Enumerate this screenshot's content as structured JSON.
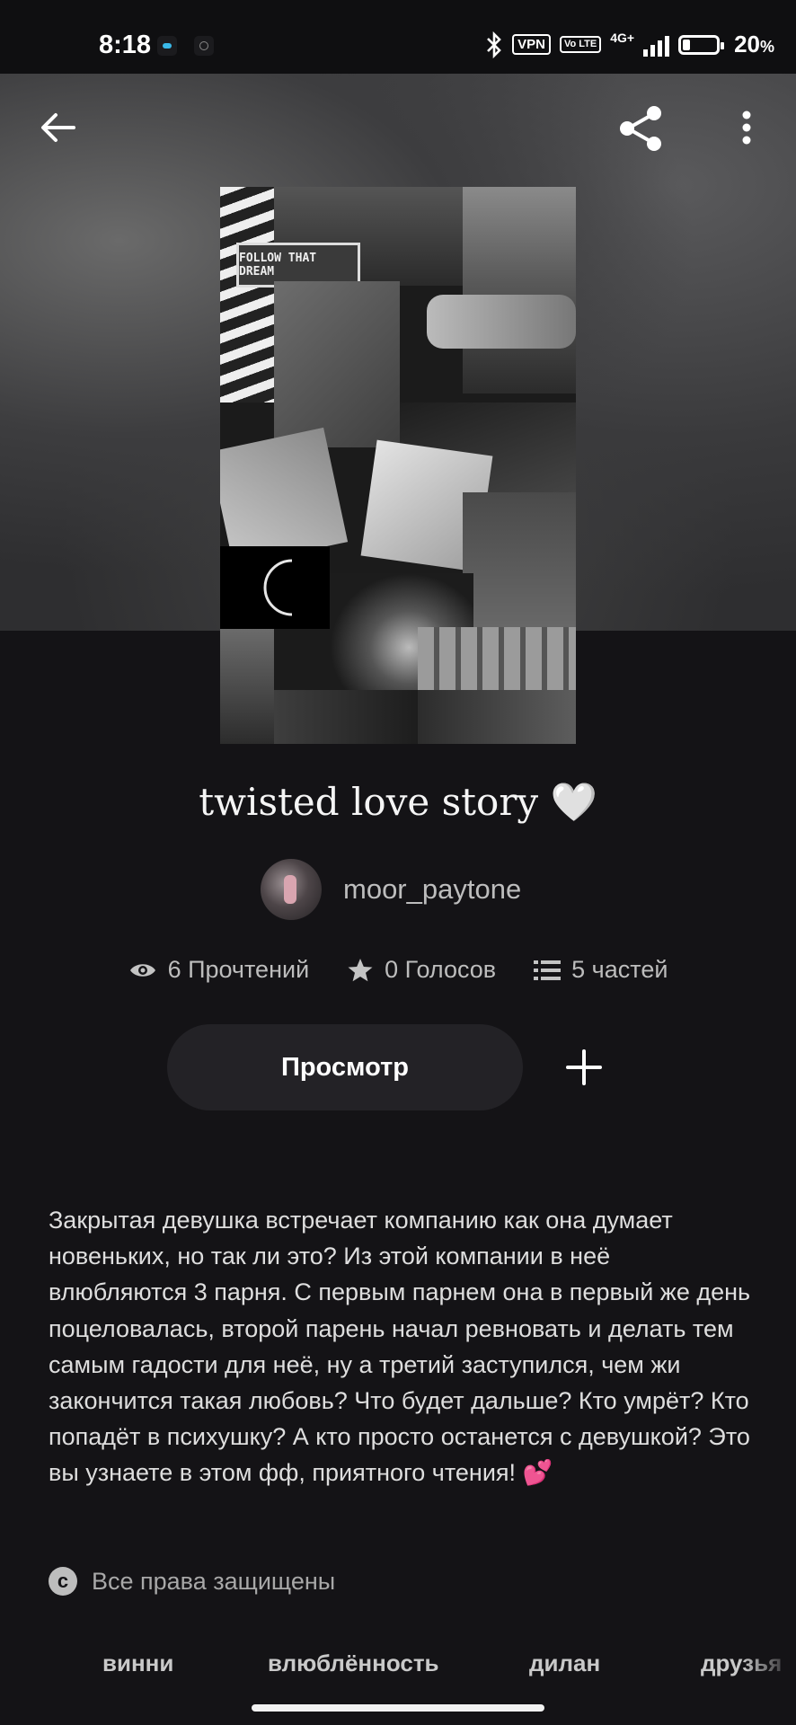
{
  "status_bar": {
    "time": "8:18",
    "vpn": "VPN",
    "volte": "Vo LTE",
    "network": "4G+",
    "battery": "20",
    "battery_unit": "%"
  },
  "header": {
    "back_icon": "arrow-left-icon",
    "share_icon": "share-icon",
    "more_icon": "more-vertical-icon"
  },
  "cover": {
    "sign_text": "FOLLOW THAT DREAM"
  },
  "story": {
    "title": "twisted love story 🤍",
    "author": "moor_paytone",
    "stats": {
      "reads": "6 Прочтений",
      "votes": "0 Голосов",
      "parts": "5 частей"
    },
    "read_button": "Просмотр",
    "description": "Закрытая девушка встречает компанию как она думает новеньких, но так ли это? Из этой компании в неё влюбляются 3 парня. С первым парнем она в первый же день поцеловалась, второй парень начал ревновать и делать тем самым гадости для неё, ну а третий заступился, чем жи закончится такая любовь? Что будет дальше? Кто умрёт? Кто попадёт в психушку? А кто просто останется с девушкой? Это вы узнаете в этом фф, приятного чтения!",
    "description_emoji": "💕",
    "copyright": "Все права защищены"
  },
  "tags": [
    "винни",
    "влюблённость",
    "дилан",
    "друзья"
  ],
  "colors": {
    "background": "#141316",
    "button_bg": "#232226",
    "text_secondary": "#bdbdbd"
  }
}
